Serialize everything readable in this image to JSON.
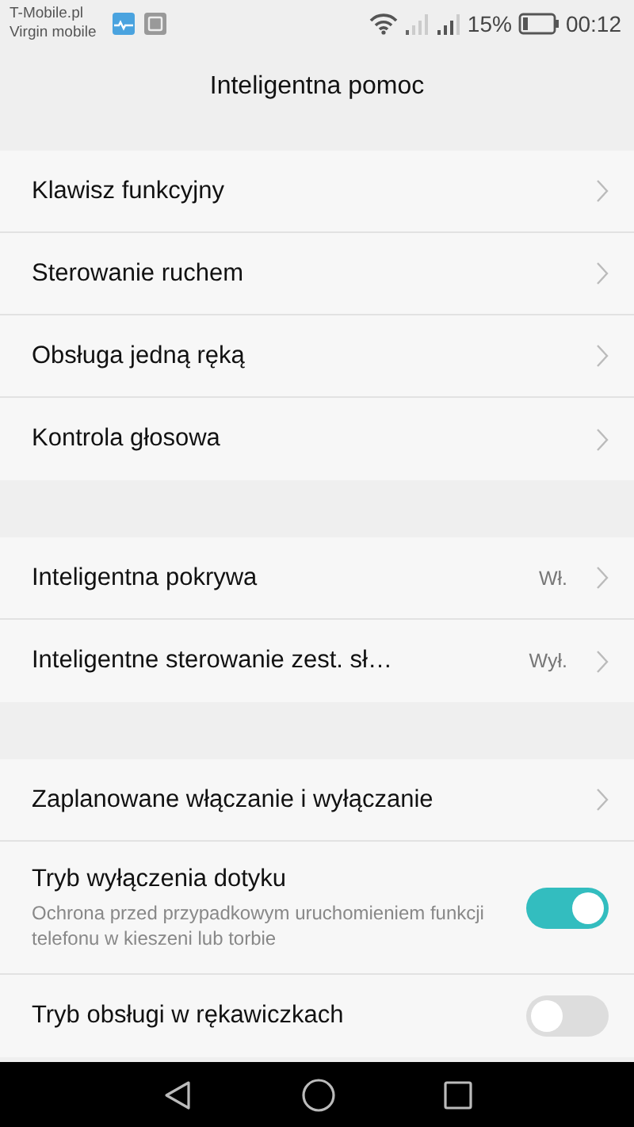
{
  "status_bar": {
    "carriers": [
      "T-Mobile.pl",
      "Virgin mobile"
    ],
    "battery_text": "15%",
    "time": "00:12"
  },
  "title": "Inteligentna pomoc",
  "sections": [
    {
      "rows": [
        {
          "kind": "link",
          "label": "Klawisz funkcyjny"
        },
        {
          "kind": "link",
          "label": "Sterowanie ruchem"
        },
        {
          "kind": "link",
          "label": "Obsługa jedną ręką"
        },
        {
          "kind": "link",
          "label": "Kontrola głosowa"
        }
      ]
    },
    {
      "rows": [
        {
          "kind": "link",
          "label": "Inteligentna pokrywa",
          "value": "Wł."
        },
        {
          "kind": "link",
          "label": "Inteligentne sterowanie zest. sł…",
          "value": "Wył."
        }
      ]
    },
    {
      "rows": [
        {
          "kind": "link",
          "label": "Zaplanowane włączanie i wyłączanie"
        },
        {
          "kind": "toggle",
          "label": "Tryb wyłączenia dotyku",
          "description": "Ochrona przed przypadkowym uruchomieniem funkcji telefonu w kieszeni lub torbie",
          "on": true
        },
        {
          "kind": "toggle",
          "label": "Tryb obsługi w rękawiczkach",
          "on": false
        }
      ]
    }
  ]
}
